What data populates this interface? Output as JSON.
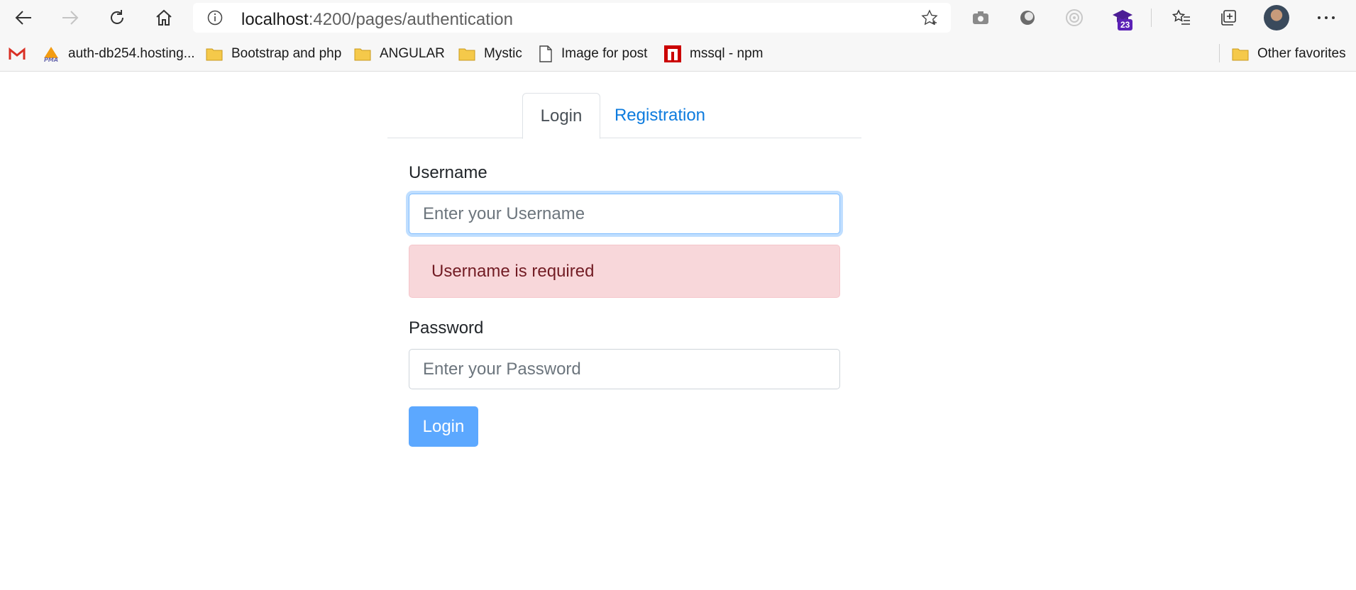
{
  "browser": {
    "address": {
      "host": "localhost",
      "path": ":4200/pages/authentication"
    },
    "extension_badge": "23",
    "icons": [
      "back-icon",
      "forward-icon",
      "refresh-icon",
      "home-icon",
      "info-icon",
      "favorite-star-icon",
      "camera-icon",
      "circle-extension-icon",
      "target-extension-icon",
      "graduation-cap-icon",
      "favorites-list-icon",
      "collections-icon",
      "avatar",
      "more-icon"
    ]
  },
  "bookmarks": {
    "items": [
      {
        "label": "",
        "icon": "gmail-icon"
      },
      {
        "label": "auth-db254.hosting...",
        "icon": "pma-icon"
      },
      {
        "label": "Bootstrap and php",
        "icon": "folder-icon"
      },
      {
        "label": "ANGULAR",
        "icon": "folder-icon"
      },
      {
        "label": "Mystic",
        "icon": "folder-icon"
      },
      {
        "label": "Image for post",
        "icon": "page-icon"
      },
      {
        "label": "mssql - npm",
        "icon": "npm-icon"
      }
    ],
    "other": "Other favorites"
  },
  "page": {
    "tabs": [
      {
        "label": "Login",
        "active": true
      },
      {
        "label": "Registration",
        "active": false
      }
    ],
    "username": {
      "label": "Username",
      "placeholder": "Enter your Username",
      "value": ""
    },
    "error": "Username is required",
    "password": {
      "label": "Password",
      "placeholder": "Enter your Password",
      "value": ""
    },
    "submit": "Login"
  },
  "colors": {
    "link": "#0d7bde",
    "alert_bg": "#f8d7da",
    "alert_text": "#721c24",
    "button": "#5ca8ff",
    "focus": "#80bdff"
  }
}
